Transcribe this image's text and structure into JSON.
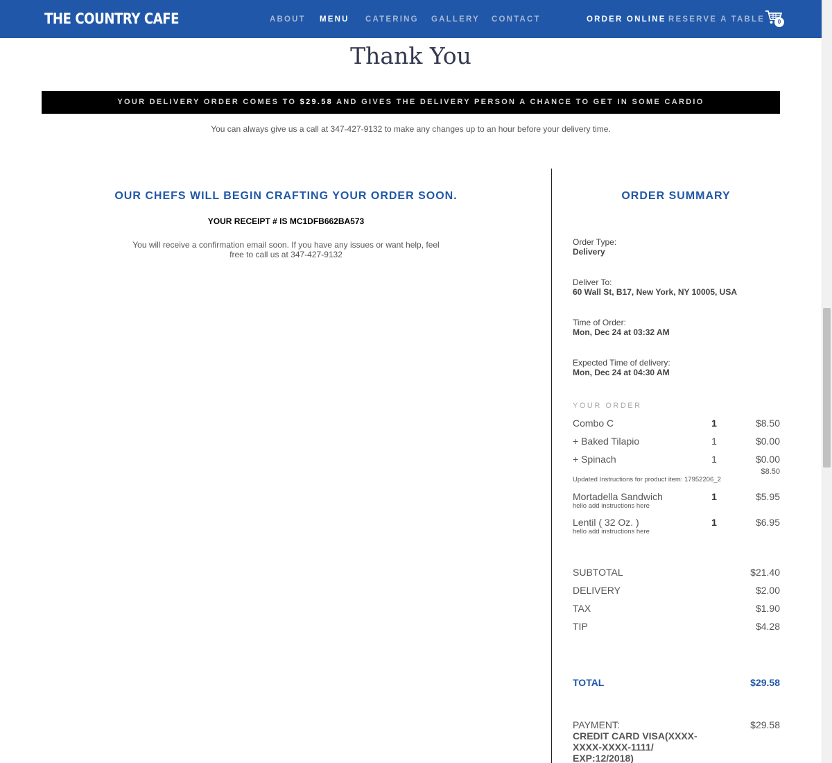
{
  "header": {
    "logo": "THE COUNTRY CAFE",
    "nav": [
      "ABOUT",
      "MENU",
      "CATERING",
      "GALLERY",
      "CONTACT"
    ],
    "order_online": "ORDER ONLINE",
    "reserve": "RESERVE A TABLE",
    "cart_count": "0"
  },
  "title": "Thank You",
  "banner": {
    "prefix": "YOUR DELIVERY ORDER COMES TO",
    "amount": "$29.58",
    "suffix": "AND GIVES THE DELIVERY PERSON A CHANCE TO GET IN SOME CARDIO"
  },
  "call_note": "You can always give us a call at 347-427-9132 to make any changes up to an hour before your delivery time.",
  "left": {
    "heading": "OUR CHEFS WILL BEGIN CRAFTING YOUR ORDER SOON.",
    "receipt": "YOUR RECEIPT # IS MC1DFB662BA573",
    "confirm": "You will receive a confirmation email soon. If you have any issues or want help, feel free to call us at 347-427-9132"
  },
  "summary": {
    "heading": "ORDER SUMMARY",
    "order_type_label": "Order Type:",
    "order_type": "Delivery",
    "deliver_to_label": "Deliver To:",
    "deliver_to": "60 Wall St, B17, New York, NY 10005, USA",
    "time_label": "Time of Order:",
    "time": "Mon, Dec 24 at 03:32 AM",
    "expected_label": "Expected Time of delivery:",
    "expected": "Mon, Dec 24 at 04:30 AM",
    "your_order": "YOUR ORDER",
    "items": [
      {
        "name": "Combo C",
        "qty": "1",
        "price": "$8.50"
      },
      {
        "name": "+ Baked Tilapio",
        "qty": "1",
        "price": "$0.00"
      },
      {
        "name": "+ Spinach",
        "qty": "1",
        "price": "$0.00"
      },
      {
        "name": "Mortadella Sandwich",
        "qty": "1",
        "price": "$5.95",
        "note": "hello add instructions here"
      },
      {
        "name": "Lentil ( 32 Oz. )",
        "qty": "1",
        "price": "$6.95",
        "note": "hello add instructions here"
      }
    ],
    "combo_subtotal": "$8.50",
    "combo_note": "Updated Instructions for product item: 17952206_2",
    "subtotal_label": "SUBTOTAL",
    "subtotal": "$21.40",
    "delivery_label": "DELIVERY",
    "delivery": "$2.00",
    "tax_label": "TAX",
    "tax": "$1.90",
    "tip_label": "TIP",
    "tip": "$4.28",
    "total_label": "TOTAL",
    "total": "$29.58",
    "payment_label": "PAYMENT:",
    "payment_amount": "$29.58",
    "payment_method": "CREDIT CARD VISA(XXXX-XXXX-XXXX-1111/ EXP:12/2018)"
  }
}
